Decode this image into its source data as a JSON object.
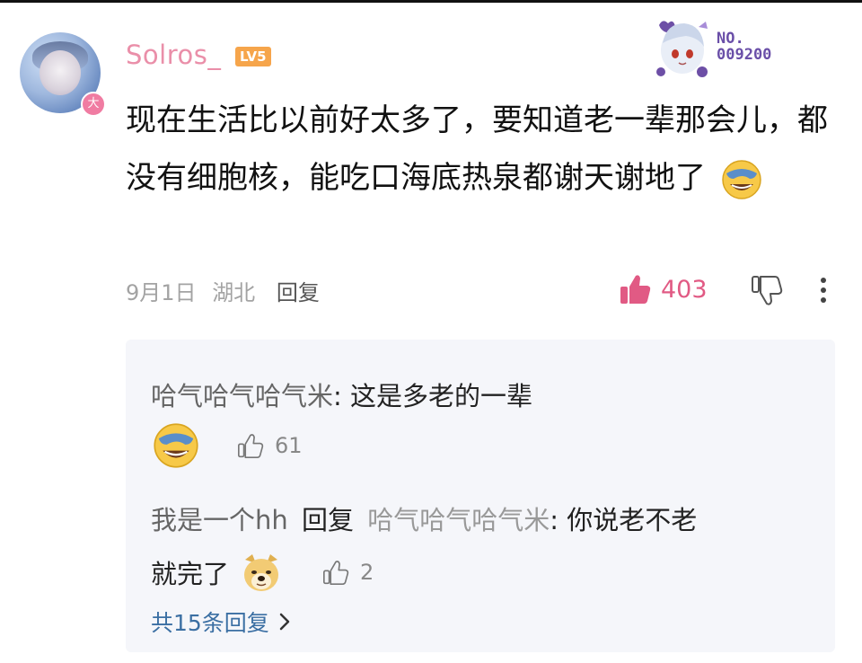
{
  "comment": {
    "username": "Solros_",
    "level": "LV5",
    "avatar_badge": "大",
    "fan_badge": {
      "line1": "NO.",
      "line2": "009200"
    },
    "text": "现在生活比以前好太多了，要知道老一辈那会儿，都没有细胞核，能吃口海底热泉都谢天谢地了",
    "date": "9月1日",
    "location": "湖北",
    "reply_label": "回复",
    "like_count": "403"
  },
  "replies": [
    {
      "nickname": "哈气哈气哈气米",
      "separator": ": ",
      "text": "这是多老的一辈",
      "like_count": "61"
    },
    {
      "nickname": "我是一个hh",
      "reply_word": "回复",
      "target": "哈气哈气哈气米",
      "separator": ": ",
      "text_line1": "你说老不老",
      "text_line2": "就完了",
      "like_count": "2"
    }
  ],
  "more_replies_label": "共15条回复",
  "colors": {
    "username": "#ea8fa9",
    "level_badge": "#f6a54b",
    "like_active": "#e15a84",
    "link": "#3b6fa3",
    "reply_bg": "#f5f6fa"
  },
  "icons": [
    "thumbs-up-filled-icon",
    "thumbs-down-outline-icon",
    "more-vertical-icon",
    "thumbs-up-outline-icon",
    "chevron-right-icon",
    "laughing-crying-emoji",
    "doge-emoji"
  ]
}
